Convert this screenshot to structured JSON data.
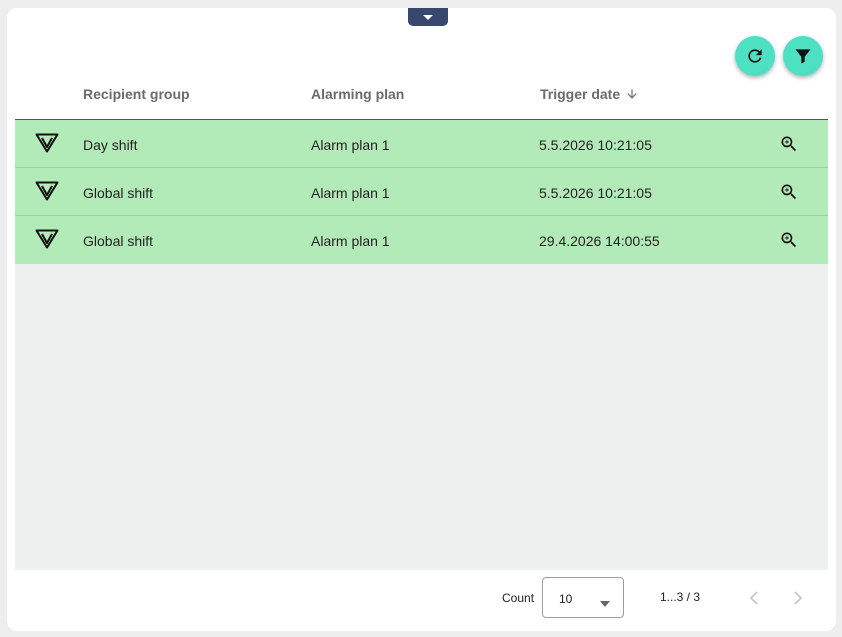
{
  "colors": {
    "accent": "#4de0c2",
    "row_background": "#b2eab8",
    "collapse_tab": "#37476e"
  },
  "toolbar": {
    "refresh_icon": "refresh-icon",
    "filter_icon": "filter-icon",
    "collapse_icon": "chevron-down-icon"
  },
  "table": {
    "headers": {
      "recipient_group": "Recipient group",
      "alarming_plan": "Alarming plan",
      "trigger_date": "Trigger date",
      "sort_icon": "arrow-down-icon"
    },
    "rows": [
      {
        "status_icon": "alarm-triangle-icon",
        "recipient_group": "Day shift",
        "alarming_plan": "Alarm plan 1",
        "trigger_date": "5.5.2026 10:21:05",
        "action_icon": "zoom-in-icon"
      },
      {
        "status_icon": "alarm-triangle-icon",
        "recipient_group": "Global shift",
        "alarming_plan": "Alarm plan 1",
        "trigger_date": "5.5.2026 10:21:05",
        "action_icon": "zoom-in-icon"
      },
      {
        "status_icon": "alarm-triangle-icon",
        "recipient_group": "Global shift",
        "alarming_plan": "Alarm plan 1",
        "trigger_date": "29.4.2026 14:00:55",
        "action_icon": "zoom-in-icon"
      }
    ]
  },
  "footer": {
    "count_label": "Count",
    "count_value": "10",
    "range": "1...3 / 3"
  }
}
